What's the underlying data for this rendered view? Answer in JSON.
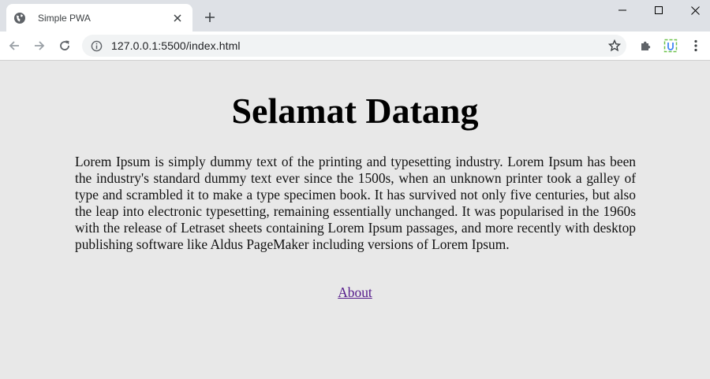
{
  "browser": {
    "tab": {
      "title": "Simple PWA",
      "favicon": "globe-icon"
    },
    "new_tab_icon": "plus-icon",
    "window_controls": [
      "minimize-icon",
      "maximize-icon",
      "close-icon"
    ],
    "nav": [
      "back-arrow-icon",
      "forward-arrow-icon",
      "reload-icon"
    ],
    "address_bar": {
      "url": "127.0.0.1:5500/index.html",
      "icon": "info-icon"
    },
    "toolbar_icons": [
      "star-icon",
      "puzzle-icon",
      "extension-icon",
      "menu-icon"
    ]
  },
  "page": {
    "heading": "Selamat Datang",
    "paragraph": "Lorem Ipsum is simply dummy text of the printing and typesetting industry. Lorem Ipsum has been the industry's standard dummy text ever since the 1500s, when an unknown printer took a galley of type and scrambled it to make a type specimen book. It has survived not only five centuries, but also the leap into electronic typesetting, remaining essentially unchanged. It was popularised in the 1960s with the release of Letraset sheets containing Lorem Ipsum passages, and more recently with desktop publishing software like Aldus PageMaker including versions of Lorem Ipsum.",
    "link": "About"
  },
  "colors": {
    "page_bg": "#e8e8e8",
    "link": "#551a8b",
    "tabstrip": "#dee1e6"
  }
}
